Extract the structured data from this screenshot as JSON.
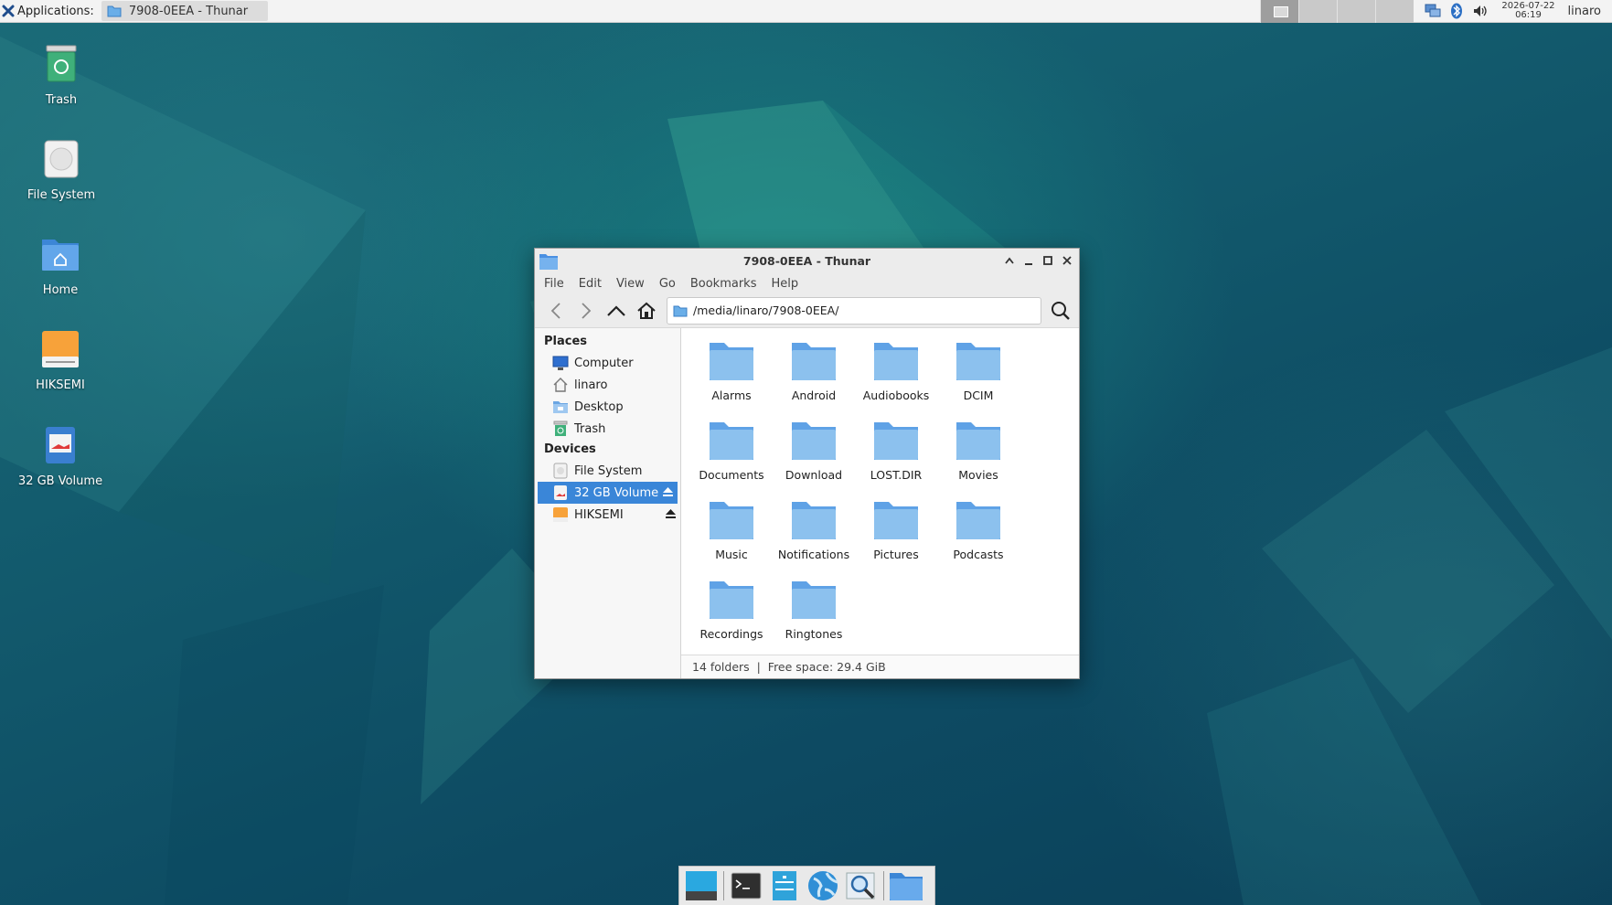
{
  "panel": {
    "applications_label": "Applications",
    "applications_suffix": ":",
    "task_title": "7908-0EEA - Thunar",
    "clock_date": "2026-07-22",
    "clock_time": "06:19",
    "user": "linaro",
    "tray_icons": [
      "network-icon",
      "bluetooth-icon",
      "volume-icon"
    ]
  },
  "desktop_icons": [
    {
      "label": "Trash",
      "icon": "trash-icon"
    },
    {
      "label": "File System",
      "icon": "drive-icon"
    },
    {
      "label": "Home",
      "icon": "home-folder-icon"
    },
    {
      "label": "HIKSEMI",
      "icon": "usb-drive-icon"
    },
    {
      "label": "32 GB Volume",
      "icon": "sd-card-icon"
    }
  ],
  "window": {
    "title": "7908-0EEA - Thunar",
    "menu": [
      "File",
      "Edit",
      "View",
      "Go",
      "Bookmarks",
      "Help"
    ],
    "location": "/media/linaro/7908-0EEA/",
    "sidebar": {
      "places_header": "Places",
      "places": [
        "Computer",
        "linaro",
        "Desktop",
        "Trash"
      ],
      "devices_header": "Devices",
      "devices": [
        "File System",
        "32 GB Volume",
        "HIKSEMI"
      ],
      "selected": "32 GB Volume"
    },
    "folders": [
      "Alarms",
      "Android",
      "Audiobooks",
      "DCIM",
      "Documents",
      "Download",
      "LOST.DIR",
      "Movies",
      "Music",
      "Notifications",
      "Pictures",
      "Podcasts",
      "Recordings",
      "Ringtones"
    ],
    "status": "14 folders  |  Free space: 29.4 GiB"
  },
  "dock": [
    "show-desktop-icon",
    "terminal-icon",
    "file-manager-icon",
    "web-browser-icon",
    "app-finder-icon",
    "folder-icon"
  ],
  "colors": {
    "accent": "#3a86d8",
    "folder": "#8cc1ee"
  }
}
